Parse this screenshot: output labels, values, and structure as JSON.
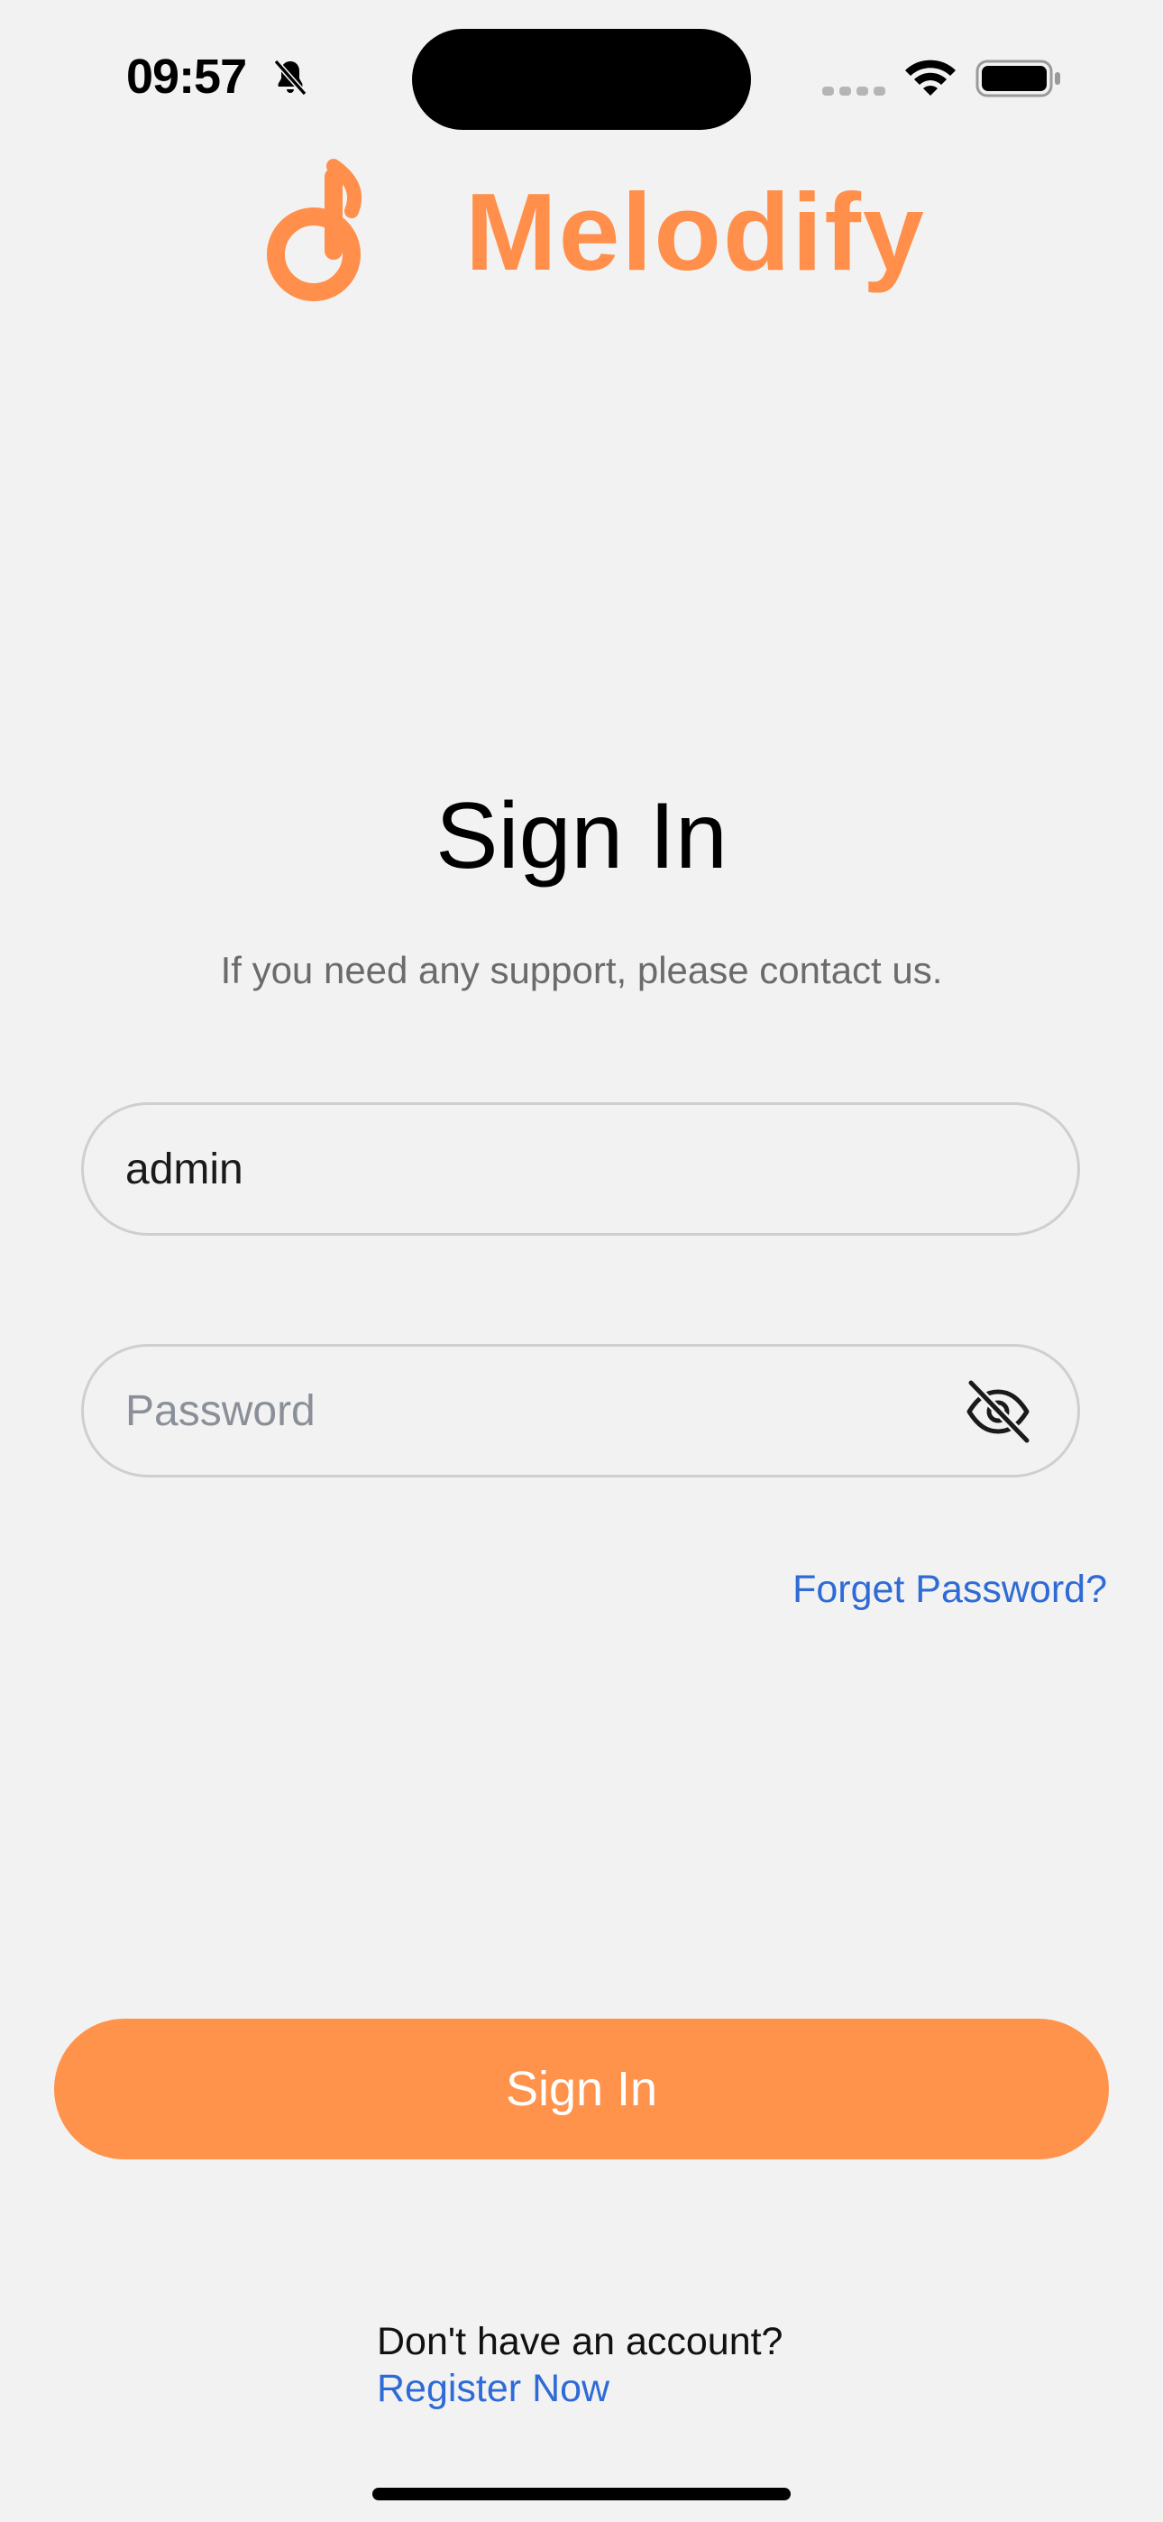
{
  "status_bar": {
    "time": "09:57",
    "icons": [
      "bell-slash-icon",
      "cellular-signal-icon",
      "wifi-icon",
      "battery-icon"
    ]
  },
  "brand": {
    "name": "Melodify",
    "logo_icon": "music-note-logo-icon",
    "color": "#ff8f4a"
  },
  "signin": {
    "title": "Sign In",
    "subtitle": "If you need any support, please contact us.",
    "username_value": "admin",
    "password_placeholder": "Password",
    "password_toggle_icon": "eye-slash-icon",
    "forgot_label": "Forget Password?",
    "button_label": "Sign In",
    "button_color": "#ff934c",
    "link_color": "#2f6bd6"
  },
  "footer": {
    "prompt": "Don't have an account?",
    "register_label": "Register Now"
  }
}
